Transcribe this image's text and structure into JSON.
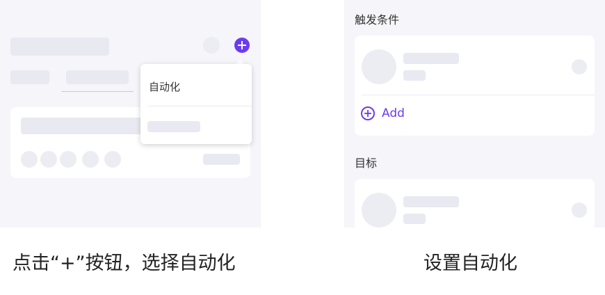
{
  "left_panel": {
    "plus_button_icon": "plus-icon",
    "popup": {
      "item_label": "自动化"
    },
    "caption": "点击“+”按钮，选择自动化"
  },
  "right_panel": {
    "trigger_section_title": "触发条件",
    "add_label": "Add",
    "add_icon": "plus-circle-icon",
    "target_section_title": "目标",
    "caption": "设置自动化"
  },
  "colors": {
    "accent": "#6a3cf0",
    "panel_bg": "#f5f5fa",
    "skeleton": "#e9e9f1"
  }
}
